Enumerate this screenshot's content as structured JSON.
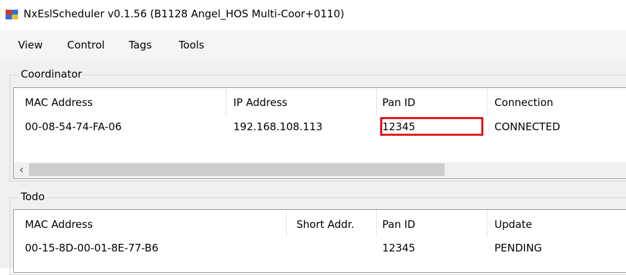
{
  "window": {
    "title": "NxEslScheduler v0.1.56 (B1128 Angel_HOS Multi-Coor+0110)",
    "icon": "app-window-icon"
  },
  "menu": [
    "View",
    "Control",
    "Tags",
    "Tools"
  ],
  "coordinator": {
    "group_label": "Coordinator",
    "columns": [
      "MAC Address",
      "IP Address",
      "Pan ID",
      "Connection"
    ],
    "rows": [
      [
        "00-08-54-74-FA-06",
        "192.168.108.113",
        "12345",
        "CONNECTED"
      ]
    ],
    "highlight_color": "#e0161b",
    "scroll_left_glyph": "‹"
  },
  "todo": {
    "group_label": "Todo",
    "columns": [
      "MAC Address",
      "Short Addr.",
      "Pan ID",
      "Update"
    ],
    "rows": [
      [
        "00-15-8D-00-01-8E-77-B6",
        "",
        "12345",
        "PENDING"
      ]
    ]
  }
}
